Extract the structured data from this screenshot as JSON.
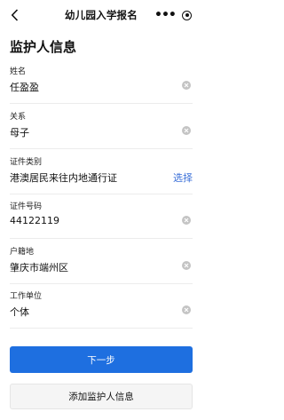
{
  "nav": {
    "title": "幼儿园入学报名",
    "more_glyph": "•••",
    "back_icon": "chevron-left-icon",
    "close_icon": "target-icon"
  },
  "page_title": "监护人信息",
  "fields": [
    {
      "label": "姓名",
      "value": "任盈盈",
      "action": "clear"
    },
    {
      "label": "关系",
      "value": "母子",
      "action": "clear"
    },
    {
      "label": "证件类别",
      "value": "港澳居民来往内地通行证",
      "action": "select",
      "action_label": "选择"
    },
    {
      "label": "证件号码",
      "value": "44122119",
      "action": "clear"
    },
    {
      "label": "户籍地",
      "value": "肇庆市端州区",
      "action": "clear"
    },
    {
      "label": "工作单位",
      "value": "个体",
      "action": "clear"
    }
  ],
  "buttons": {
    "next": "下一步",
    "add_guardian": "添加监护人信息"
  },
  "colors": {
    "primary": "#1e6fe0",
    "link": "#3a6fd8",
    "clear_icon": "#c4c4c4"
  }
}
